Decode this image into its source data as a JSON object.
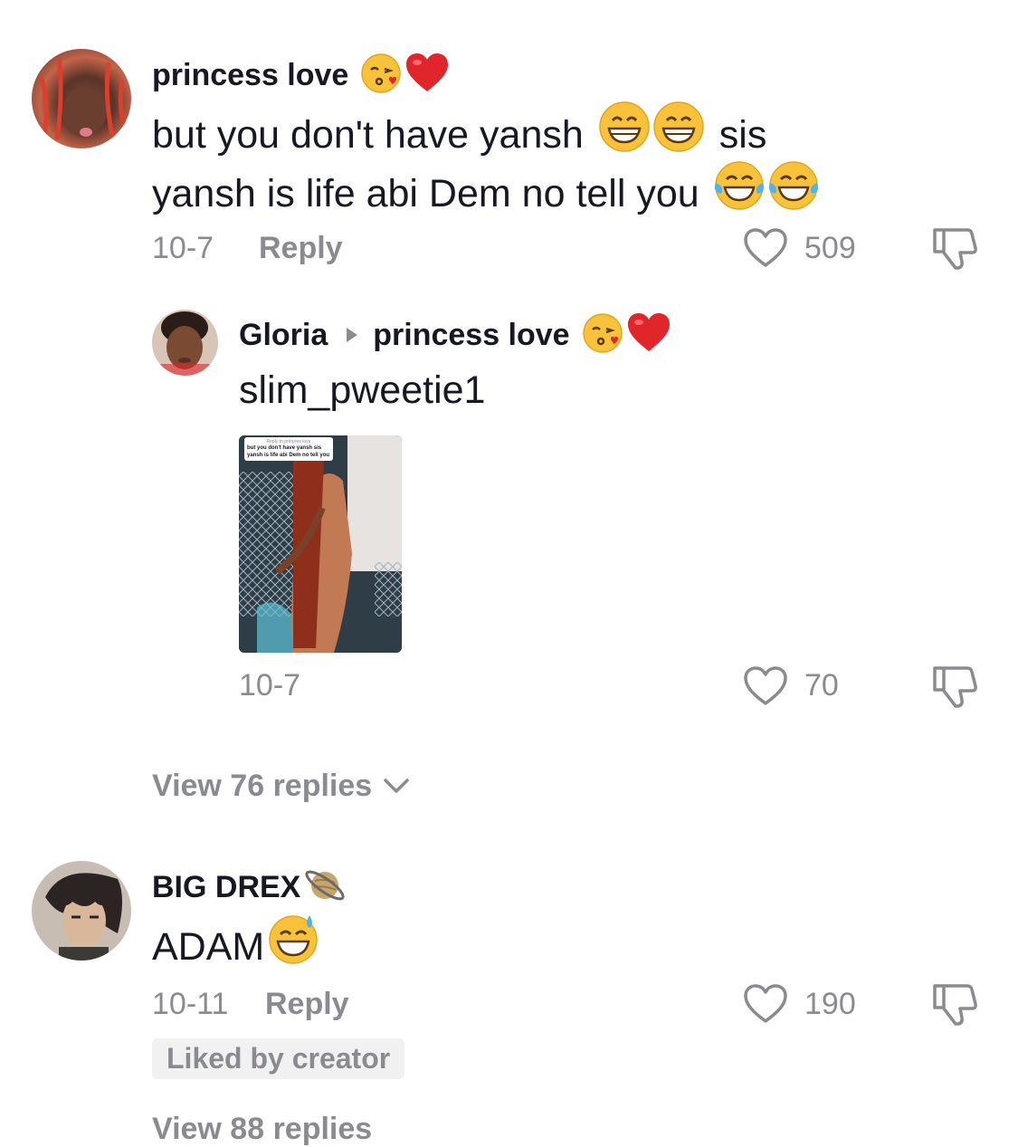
{
  "colors": {
    "text": "#161823",
    "secondary": "#8a8b91",
    "heart_red": "#e0252b"
  },
  "comments": [
    {
      "username": "princess love",
      "text_line1": "but you don't have yansh",
      "text_line1_tail": "sis",
      "text_line2": "yansh is life abi Dem no tell you",
      "date": "10-7",
      "reply_label": "Reply",
      "likes": "509",
      "replies": [
        {
          "username": "Gloria",
          "reply_to": "princess love",
          "text": "slim_pweetie1",
          "thumbnail_overlay": {
            "header": "Reply to princess love",
            "text": "but you don't have yansh sis yansh is life abi Dem no tell you"
          },
          "date": "10-7",
          "likes": "70"
        }
      ],
      "view_replies_label": "View 76 replies"
    },
    {
      "username": "BIG DREX",
      "text": "ADAM",
      "date": "10-11",
      "reply_label": "Reply",
      "likes": "190",
      "badge": "Liked by creator",
      "view_replies_label": "View 88 replies"
    }
  ],
  "icons": [
    "heart-outline-icon",
    "dislike-icon",
    "chevron-down-icon",
    "triangle-right-icon",
    "kiss-emoji",
    "red-heart-emoji",
    "grin-emoji",
    "tears-of-joy-emoji",
    "sweat-smile-emoji",
    "ringed-planet-emoji"
  ]
}
